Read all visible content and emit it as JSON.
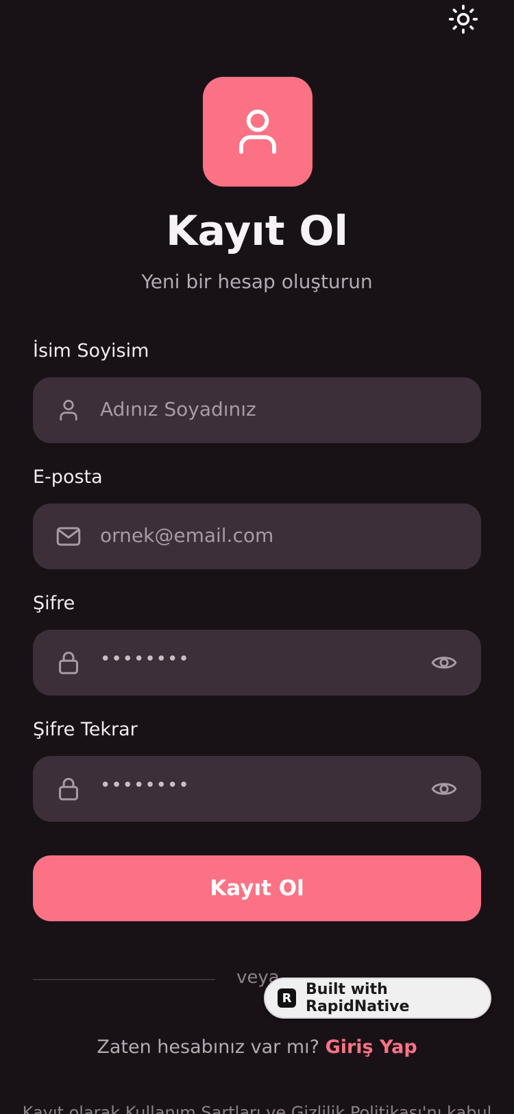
{
  "theme": {
    "background": "#181217",
    "accent": "#fb7285",
    "field_background": "#3c2f39",
    "muted_text": "#b6a9b3",
    "toggle_icon": "sun-icon"
  },
  "header": {
    "logo_icon": "user-icon",
    "title": "Kayıt Ol",
    "subtitle": "Yeni bir hesap oluşturun"
  },
  "form": {
    "name": {
      "label": "İsim Soyisim",
      "placeholder": "Adınız Soyadınız",
      "icon": "user-icon"
    },
    "email": {
      "label": "E-posta",
      "placeholder": "ornek@email.com",
      "icon": "mail-icon"
    },
    "password": {
      "label": "Şifre",
      "value": "••••••••",
      "icon": "lock-icon",
      "toggle_icon": "eye-icon"
    },
    "password_confirm": {
      "label": "Şifre Tekrar",
      "value": "••••••••",
      "icon": "lock-icon",
      "toggle_icon": "eye-icon"
    },
    "submit_label": "Kayıt Ol"
  },
  "divider": {
    "text": "veya"
  },
  "badge": {
    "text": "Built with RapidNative",
    "logo": "R"
  },
  "footer": {
    "question": "Zaten hesabınız var mı?",
    "login_link": "Giriş Yap",
    "terms": "Kayıt olarak Kullanım Şartları ve Gizlilik Politikası'nı kabul"
  }
}
